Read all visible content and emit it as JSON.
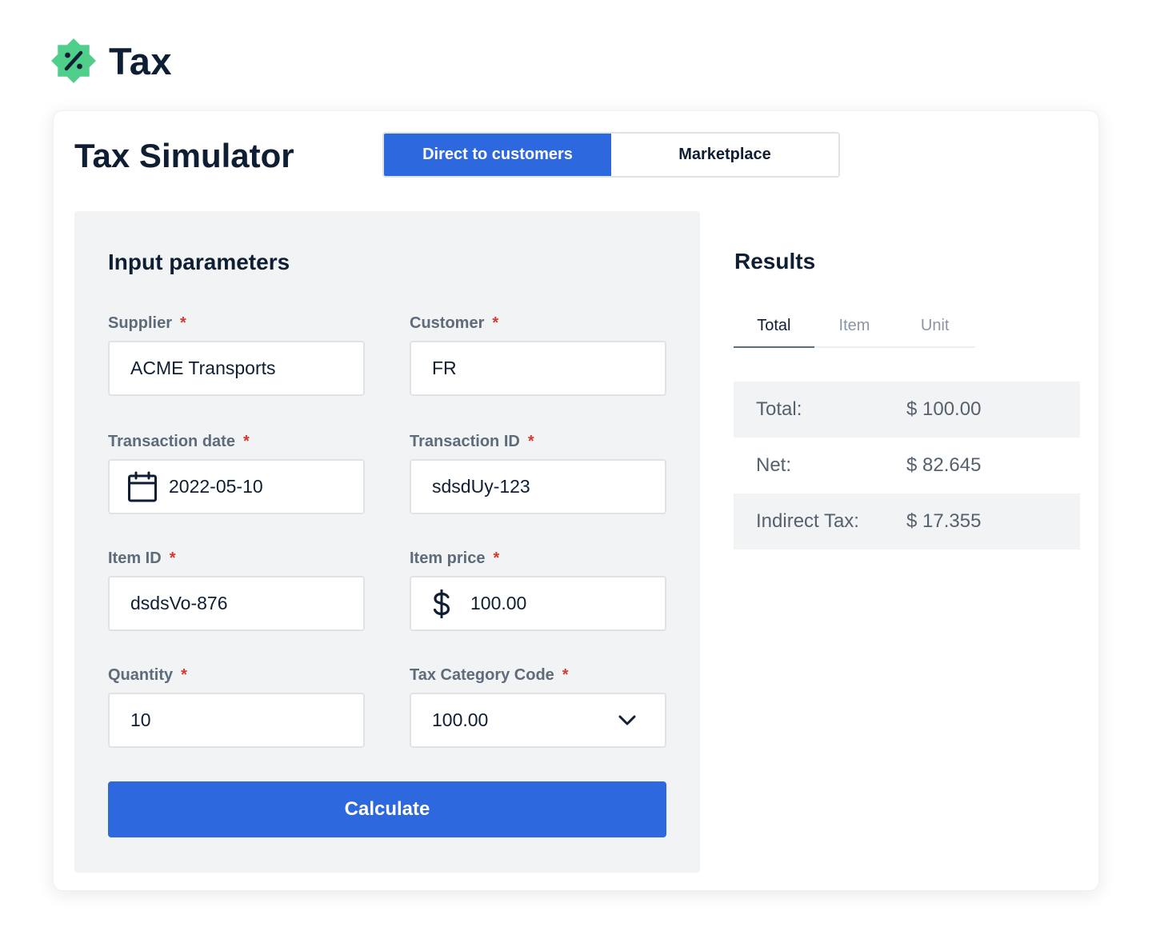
{
  "brand": {
    "name": "Tax",
    "logo_icon": "percent-badge-icon",
    "logo_color": "#4fcf8a"
  },
  "simulator": {
    "title": "Tax Simulator",
    "modes": [
      {
        "label": "Direct to customers",
        "active": true
      },
      {
        "label": "Marketplace",
        "active": false
      }
    ]
  },
  "inputs": {
    "title": "Input parameters",
    "required_mark": "*",
    "supplier": {
      "label": "Supplier",
      "value": "ACME Transports"
    },
    "customer": {
      "label": "Customer",
      "value": "FR"
    },
    "transaction_date": {
      "label": "Transaction date",
      "value": "2022-05-10",
      "icon": "calendar-icon"
    },
    "transaction_id": {
      "label": "Transaction ID",
      "value": "sdsdUy-123"
    },
    "item_id": {
      "label": "Item ID",
      "value": "dsdsVo-876"
    },
    "item_price": {
      "label": "Item price",
      "value": "100.00",
      "icon": "dollar-icon"
    },
    "quantity": {
      "label": "Quantity",
      "value": "10"
    },
    "tax_category": {
      "label": "Tax Category Code",
      "value": "100.00",
      "icon": "chevron-down-icon"
    },
    "calculate_label": "Calculate"
  },
  "results": {
    "title": "Results",
    "tabs": [
      {
        "label": "Total",
        "active": true
      },
      {
        "label": "Item",
        "active": false
      },
      {
        "label": "Unit",
        "active": false
      }
    ],
    "rows": [
      {
        "label": "Total:",
        "value": "$ 100.00"
      },
      {
        "label": "Net:",
        "value": "$ 82.645"
      },
      {
        "label": "Indirect Tax:",
        "value": "$ 17.355"
      }
    ]
  },
  "colors": {
    "primary": "#2d68de",
    "required": "#d33a2c",
    "panel_bg": "#f2f3f5",
    "text": "#0f1e33",
    "muted": "#5d6b7b"
  }
}
